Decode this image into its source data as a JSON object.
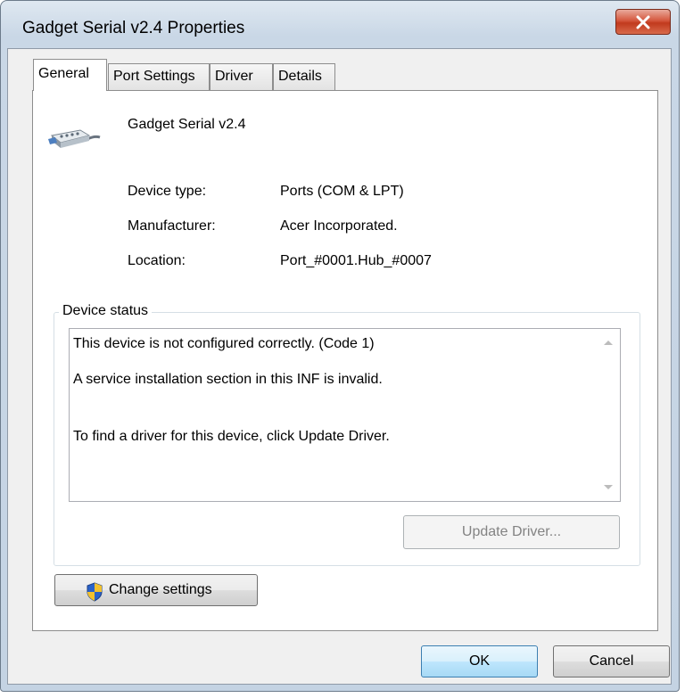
{
  "window": {
    "title": "Gadget Serial v2.4 Properties"
  },
  "tabs": [
    {
      "label": "General",
      "active": true
    },
    {
      "label": "Port Settings",
      "active": false
    },
    {
      "label": "Driver",
      "active": false
    },
    {
      "label": "Details",
      "active": false
    }
  ],
  "device": {
    "name": "Gadget Serial v2.4",
    "icon": "serial-cable-icon",
    "fields": [
      {
        "label": "Device type:",
        "value": "Ports (COM & LPT)"
      },
      {
        "label": "Manufacturer:",
        "value": "Acer Incorporated."
      },
      {
        "label": "Location:",
        "value": "Port_#0001.Hub_#0007"
      }
    ]
  },
  "status": {
    "group_label": "Device status",
    "lines": [
      "This device is not configured correctly. (Code 1)",
      "A service installation section in this INF is invalid.",
      "To find a driver for this device, click Update Driver."
    ]
  },
  "buttons": {
    "update_driver": "Update Driver...",
    "change_settings": "Change settings",
    "ok": "OK",
    "cancel": "Cancel"
  },
  "colors": {
    "close_button": "#c13a1d",
    "uac_shield_blue": "#2a62c9",
    "uac_shield_yellow": "#f2c12e"
  }
}
